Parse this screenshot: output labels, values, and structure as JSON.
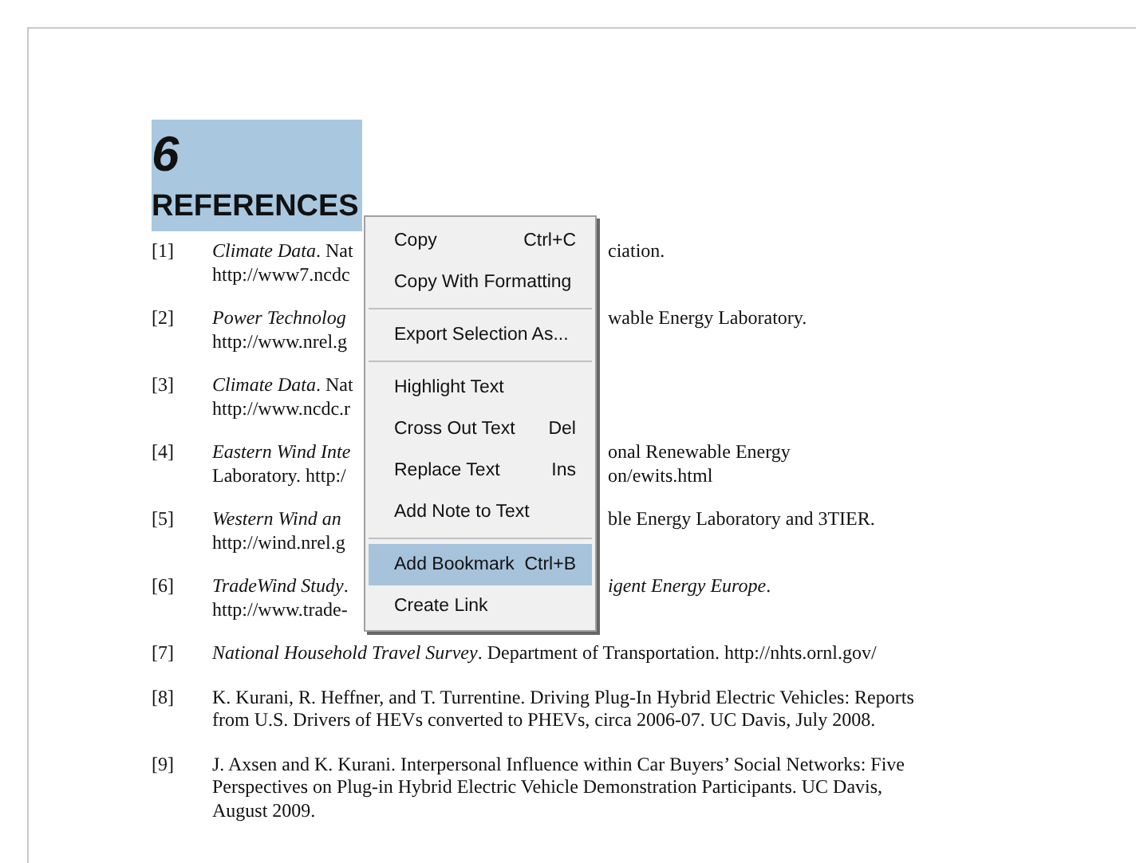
{
  "section": {
    "number": "6",
    "title": "REFERENCES",
    "selected": true
  },
  "references": [
    {
      "number": "[1]",
      "lines": [
        {
          "left": "*Climate Data*. Nat",
          "right": "ciation."
        },
        {
          "left": "http://www7.ncdc"
        }
      ]
    },
    {
      "number": "[2]",
      "lines": [
        {
          "left": "*Power Technolog*",
          "right": "wable Energy Laboratory."
        },
        {
          "left": "http://www.nrel.g"
        }
      ]
    },
    {
      "number": "[3]",
      "lines": [
        {
          "left": "*Climate Data*. Nat"
        },
        {
          "left": "http://www.ncdc.r"
        }
      ]
    },
    {
      "number": "[4]",
      "lines": [
        {
          "left": "*Eastern Wind Inte*",
          "right": "onal Renewable Energy"
        },
        {
          "left": "Laboratory. http:/",
          "right": "on/ewits.html"
        }
      ]
    },
    {
      "number": "[5]",
      "lines": [
        {
          "left": "*Western Wind an*",
          "right": "ble Energy Laboratory and 3TIER."
        },
        {
          "left": "http://wind.nrel.g"
        }
      ]
    },
    {
      "number": "[6]",
      "lines": [
        {
          "left": "*TradeWind Study*.",
          "right": "*igent Energy Europe*."
        },
        {
          "left": "http://www.trade-"
        }
      ]
    },
    {
      "number": "[7]",
      "text": "*National Household Travel Survey*. Department of Transportation. http://nhts.ornl.gov/"
    },
    {
      "number": "[8]",
      "text": "K. Kurani, R. Heffner, and T. Turrentine. Driving Plug-In Hybrid Electric Vehicles: Reports from U.S. Drivers of HEVs converted to PHEVs, circa 2006-07. UC Davis, July 2008."
    },
    {
      "number": "[9]",
      "text": "J. Axsen and K. Kurani. Interpersonal Influence within Car Buyers’ Social Networks: Five Perspectives on Plug-in Hybrid Electric Vehicle Demonstration Participants. UC Davis, August 2009."
    }
  ],
  "context_menu": [
    {
      "kind": "item",
      "label": "Copy",
      "shortcut": "Ctrl+C",
      "selected": false
    },
    {
      "kind": "item",
      "label": "Copy With Formatting",
      "selected": false
    },
    {
      "kind": "separator"
    },
    {
      "kind": "item",
      "label": "Export Selection As...",
      "selected": false
    },
    {
      "kind": "separator"
    },
    {
      "kind": "item",
      "label": "Highlight Text",
      "selected": false
    },
    {
      "kind": "item",
      "label": "Cross Out Text",
      "shortcut": "Del",
      "selected": false
    },
    {
      "kind": "item",
      "label": "Replace Text",
      "shortcut": "Ins",
      "selected": false
    },
    {
      "kind": "item",
      "label": "Add Note to Text",
      "selected": false
    },
    {
      "kind": "separator"
    },
    {
      "kind": "item",
      "label": "Add Bookmark",
      "shortcut": "Ctrl+B",
      "selected": true
    },
    {
      "kind": "item",
      "label": "Create Link",
      "selected": false
    }
  ]
}
